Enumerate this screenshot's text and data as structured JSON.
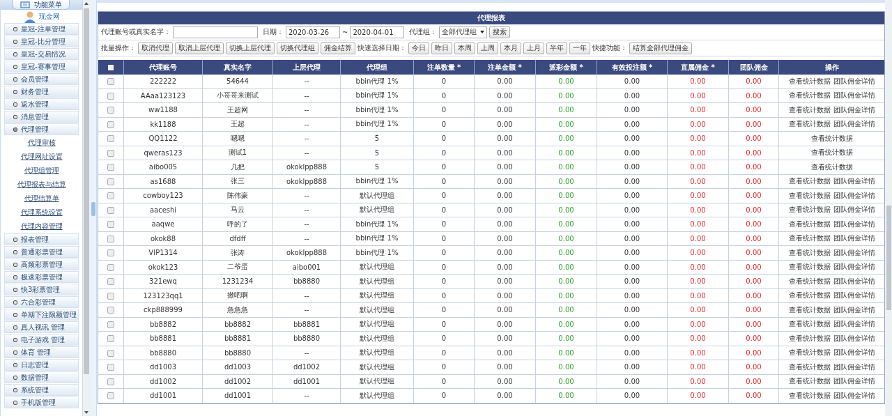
{
  "sidebar": {
    "title": "功能菜单",
    "user": "现金网",
    "items": [
      {
        "label": "皇冠-注单管理",
        "expanded": false
      },
      {
        "label": "皇冠-比分管理",
        "expanded": false
      },
      {
        "label": "皇冠-交易情况",
        "expanded": false
      },
      {
        "label": "皇冠-赛事管理",
        "expanded": false
      },
      {
        "label": "会员管理",
        "expanded": false
      },
      {
        "label": "财务管理",
        "expanded": false
      },
      {
        "label": "返水管理",
        "expanded": false
      },
      {
        "label": "消息管理",
        "expanded": false
      },
      {
        "label": "代理管理",
        "expanded": true,
        "children": [
          "代理审核",
          "代理网址设置",
          "代理组管理",
          "代理报表与结算",
          "代理结算单",
          "代理系统设置",
          "代理内容管理"
        ]
      },
      {
        "label": "报表管理",
        "expanded": false
      },
      {
        "label": "普通彩票管理",
        "expanded": false
      },
      {
        "label": "高频彩票管理",
        "expanded": false
      },
      {
        "label": "极速彩票管理",
        "expanded": false
      },
      {
        "label": "快3彩票管理",
        "expanded": false
      },
      {
        "label": "六合彩管理",
        "expanded": false
      },
      {
        "label": "单期下注限额管理",
        "expanded": false
      },
      {
        "label": "真人视讯 管理",
        "expanded": false
      },
      {
        "label": "电子游戏 管理",
        "expanded": false
      },
      {
        "label": "体育 管理",
        "expanded": false
      },
      {
        "label": "日志管理",
        "expanded": false
      },
      {
        "label": "数据管理",
        "expanded": false
      },
      {
        "label": "系统管理",
        "expanded": false
      },
      {
        "label": "手机版管理",
        "expanded": false
      }
    ]
  },
  "panel": {
    "title": "代理报表",
    "filters": {
      "name_label": "代理账号或真实名字：",
      "date_label": "日期：",
      "date_from": "2020-03-26",
      "date_sep": "~",
      "date_to": "2020-04-01",
      "group_label": "代理组：",
      "group_value": "全部代理组",
      "search_button": "搜索"
    },
    "batch_label": "批量操作：",
    "batch_buttons": [
      "取消代理",
      "取消上层代理",
      "切换上层代理",
      "切换代理组",
      "佣金结算"
    ],
    "quick_label": "快速选择日期：",
    "quick_buttons": [
      "今日",
      "昨日",
      "本周",
      "上周",
      "本月",
      "上月",
      "半年",
      "一年"
    ],
    "shortcut_label": "快捷功能：",
    "shortcut_button": "结算全部代理佣金"
  },
  "table": {
    "all_selected": false,
    "columns": [
      {
        "label": "代理账号",
        "kind": "text"
      },
      {
        "label": "真实名字",
        "kind": "text"
      },
      {
        "label": "上层代理",
        "kind": "text"
      },
      {
        "label": "代理组",
        "kind": "text"
      },
      {
        "label": "注单数量 *",
        "kind": "text"
      },
      {
        "label": "注单金额 *",
        "kind": "text"
      },
      {
        "label": "派彩金额 *",
        "kind": "payout"
      },
      {
        "label": "有效投注额 *",
        "kind": "text"
      },
      {
        "label": "直属佣金 *",
        "kind": "commission"
      },
      {
        "label": "团队佣金",
        "kind": "commission"
      },
      {
        "label": "操作",
        "kind": "actions"
      }
    ],
    "rows": [
      {
        "selected": false,
        "cells": [
          "222222",
          "54644",
          "--",
          "bbin代理 1%",
          "0",
          "0.00",
          "0.00",
          "0.00",
          "0.00",
          "0.00"
        ],
        "actions": [
          "查看统计数据",
          "团队佣金详情"
        ]
      },
      {
        "selected": false,
        "cells": [
          "AAaa123123",
          "小哥哥来测试",
          "--",
          "bbin代理 1%",
          "0",
          "0.00",
          "0.00",
          "0.00",
          "0.00",
          "0.00"
        ],
        "actions": [
          "查看统计数据",
          "团队佣金详情"
        ]
      },
      {
        "selected": false,
        "cells": [
          "ww1188",
          "王超网",
          "--",
          "bbin代理 1%",
          "0",
          "0.00",
          "0.00",
          "0.00",
          "0.00",
          "0.00"
        ],
        "actions": [
          "查看统计数据",
          "团队佣金详情"
        ]
      },
      {
        "selected": false,
        "cells": [
          "kk1188",
          "王超",
          "--",
          "bbin代理 1%",
          "0",
          "0.00",
          "0.00",
          "0.00",
          "0.00",
          "0.00"
        ],
        "actions": [
          "查看统计数据",
          "团队佣金详情"
        ]
      },
      {
        "selected": false,
        "cells": [
          "QQ1122",
          "嗯嗯",
          "--",
          "5",
          "0",
          "0.00",
          "0.00",
          "0.00",
          "0.00",
          "0.00"
        ],
        "actions": [
          "查看统计数据"
        ]
      },
      {
        "selected": false,
        "cells": [
          "qweras123",
          "测试1",
          "--",
          "5",
          "0",
          "0.00",
          "0.00",
          "0.00",
          "0.00",
          "0.00"
        ],
        "actions": [
          "查看统计数据"
        ]
      },
      {
        "selected": false,
        "cells": [
          "aibo005",
          "几把",
          "okoklpp888",
          "5",
          "0",
          "0.00",
          "0.00",
          "0.00",
          "0.00",
          "0.00"
        ],
        "actions": [
          "查看统计数据"
        ]
      },
      {
        "selected": false,
        "cells": [
          "as1688",
          "张三",
          "okoklpp888",
          "bbin代理 1%",
          "0",
          "0.00",
          "0.00",
          "0.00",
          "0.00",
          "0.00"
        ],
        "actions": [
          "查看统计数据",
          "团队佣金详情"
        ]
      },
      {
        "selected": false,
        "cells": [
          "cowboy123",
          "陈伟豪",
          "--",
          "默认代理组",
          "0",
          "0.00",
          "0.00",
          "0.00",
          "0.00",
          "0.00"
        ],
        "actions": [
          "查看统计数据",
          "团队佣金详情"
        ]
      },
      {
        "selected": false,
        "cells": [
          "aaceshi",
          "马云",
          "--",
          "默认代理组",
          "0",
          "0.00",
          "0.00",
          "0.00",
          "0.00",
          "0.00"
        ],
        "actions": [
          "查看统计数据",
          "团队佣金详情"
        ]
      },
      {
        "selected": false,
        "cells": [
          "aaqwe",
          "呼的了",
          "--",
          "bbin代理 1%",
          "0",
          "0.00",
          "0.00",
          "0.00",
          "0.00",
          "0.00"
        ],
        "actions": [
          "查看统计数据",
          "团队佣金详情"
        ]
      },
      {
        "selected": false,
        "cells": [
          "okok88",
          "dfdff",
          "--",
          "bbin代理 1%",
          "0",
          "0.00",
          "0.00",
          "0.00",
          "0.00",
          "0.00"
        ],
        "actions": [
          "查看统计数据",
          "团队佣金详情"
        ]
      },
      {
        "selected": false,
        "cells": [
          "VIP1314",
          "张涛",
          "okoklpp888",
          "bbin代理 1%",
          "0",
          "0.00",
          "0.00",
          "0.00",
          "0.00",
          "0.00"
        ],
        "actions": [
          "查看统计数据",
          "团队佣金详情"
        ]
      },
      {
        "selected": false,
        "cells": [
          "okok123",
          "二爷蛋",
          "aibo001",
          "默认代理组",
          "0",
          "0.00",
          "0.00",
          "0.00",
          "0.00",
          "0.00"
        ],
        "actions": [
          "查看统计数据",
          "团队佣金详情"
        ]
      },
      {
        "selected": false,
        "cells": [
          "321ewq",
          "1231234",
          "bb8880",
          "默认代理组",
          "0",
          "0.00",
          "0.00",
          "0.00",
          "0.00",
          "0.00"
        ],
        "actions": [
          "查看统计数据",
          "团队佣金详情"
        ]
      },
      {
        "selected": false,
        "cells": [
          "123123qq1",
          "撤吧啊",
          "--",
          "默认代理组",
          "0",
          "0.00",
          "0.00",
          "0.00",
          "0.00",
          "0.00"
        ],
        "actions": [
          "查看统计数据",
          "团队佣金详情"
        ]
      },
      {
        "selected": false,
        "cells": [
          "ckp888999",
          "急急急",
          "--",
          "默认代理组",
          "0",
          "0.00",
          "0.00",
          "0.00",
          "0.00",
          "0.00"
        ],
        "actions": [
          "查看统计数据",
          "团队佣金详情"
        ]
      },
      {
        "selected": false,
        "cells": [
          "bb8882",
          "bb8882",
          "bb8881",
          "默认代理组",
          "0",
          "0.00",
          "0.00",
          "0.00",
          "0.00",
          "0.00"
        ],
        "actions": [
          "查看统计数据",
          "团队佣金详情"
        ]
      },
      {
        "selected": false,
        "cells": [
          "bb8881",
          "bb8881",
          "bb8880",
          "默认代理组",
          "0",
          "0.00",
          "0.00",
          "0.00",
          "0.00",
          "0.00"
        ],
        "actions": [
          "查看统计数据",
          "团队佣金详情"
        ]
      },
      {
        "selected": false,
        "cells": [
          "bb8880",
          "bb8880",
          "--",
          "默认代理组",
          "0",
          "0.00",
          "0.00",
          "0.00",
          "0.00",
          "0.00"
        ],
        "actions": [
          "查看统计数据",
          "团队佣金详情"
        ]
      },
      {
        "selected": false,
        "cells": [
          "dd1003",
          "dd1003",
          "dd1002",
          "默认代理组",
          "0",
          "0.00",
          "0.00",
          "0.00",
          "0.00",
          "0.00"
        ],
        "actions": [
          "查看统计数据",
          "团队佣金详情"
        ]
      },
      {
        "selected": false,
        "cells": [
          "dd1002",
          "dd1002",
          "dd1001",
          "默认代理组",
          "0",
          "0.00",
          "0.00",
          "0.00",
          "0.00",
          "0.00"
        ],
        "actions": [
          "查看统计数据",
          "团队佣金详情"
        ]
      },
      {
        "selected": false,
        "cells": [
          "dd1001",
          "dd1001",
          "--",
          "默认代理组",
          "0",
          "0.00",
          "0.00",
          "0.00",
          "0.00",
          "0.00"
        ],
        "actions": [
          "查看统计数据",
          "团队佣金详情"
        ]
      }
    ]
  }
}
